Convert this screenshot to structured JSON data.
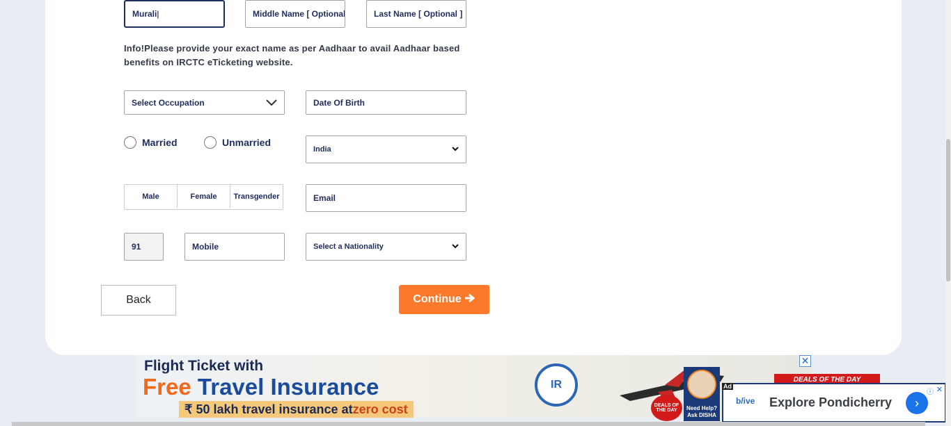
{
  "form": {
    "first_name_value": "Murali",
    "middle_name_placeholder": "Middle Name  [ Optional ]",
    "last_name_placeholder": "Last Name  [ Optional ]",
    "info_text": "Info!Please provide your exact name as per Aadhaar to avail Aadhaar based benefits on IRCTC eTicketing website.",
    "occupation_label": "Select Occupation",
    "dob_placeholder": "Date Of Birth",
    "marital": [
      "Married",
      "Unmarried"
    ],
    "country_value": "India",
    "gender": [
      "Male",
      "Female",
      "Transgender"
    ],
    "email_placeholder": "Email",
    "country_code": "91",
    "mobile_placeholder": "Mobile",
    "nationality_label": "Select a Nationality",
    "back_label": "Back",
    "continue_label": "Continue"
  },
  "banner": {
    "line1": "Flight Ticket with",
    "line2_a": "Free",
    "line2_b": " Travel Insurance",
    "line3_a": "₹ 50 lakh travel insurance at ",
    "line3_b": "zero cost",
    "deals_badge": "DEALS OF THE DAY",
    "disha_text": "Need Help? Ask DISHA",
    "deals_tag": "DEALS OF THE DAY"
  },
  "ad": {
    "label": "Ad",
    "brand": "b/ive",
    "text": "Explore Pondicherry"
  },
  "colors": {
    "accent": "#fb792b",
    "navy": "#1f2d5c",
    "ad_blue": "#1a73e8"
  }
}
